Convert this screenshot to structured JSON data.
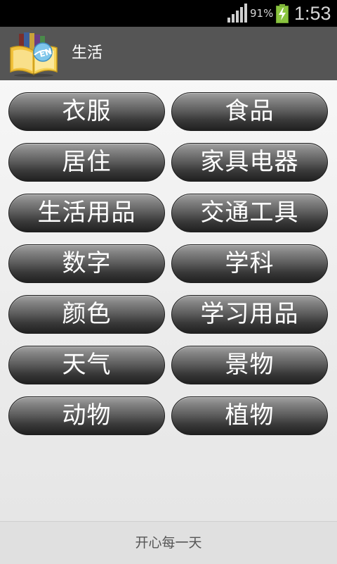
{
  "status_bar": {
    "battery_percent": "91%",
    "time": "1:53",
    "icons": [
      "signal-icon",
      "battery-charging-icon"
    ]
  },
  "header": {
    "title": "生活",
    "logo_icon": "book-en-logo-icon"
  },
  "categories": [
    {
      "label": "衣服"
    },
    {
      "label": "食品"
    },
    {
      "label": "居住"
    },
    {
      "label": "家具电器"
    },
    {
      "label": "生活用品"
    },
    {
      "label": "交通工具"
    },
    {
      "label": "数字"
    },
    {
      "label": "学科"
    },
    {
      "label": "颜色"
    },
    {
      "label": "学习用品"
    },
    {
      "label": "天气"
    },
    {
      "label": "景物"
    },
    {
      "label": "动物"
    },
    {
      "label": "植物"
    }
  ],
  "footer": {
    "text": "开心每一天"
  },
  "colors": {
    "status_bar": "#000000",
    "header": "#555555",
    "content_bg": "#efefef",
    "button_top": "#a2a2a2",
    "button_bottom": "#202020",
    "button_text": "#ffffff",
    "footer_bg": "#e0e0e0",
    "battery_green": "#8ac43f"
  }
}
